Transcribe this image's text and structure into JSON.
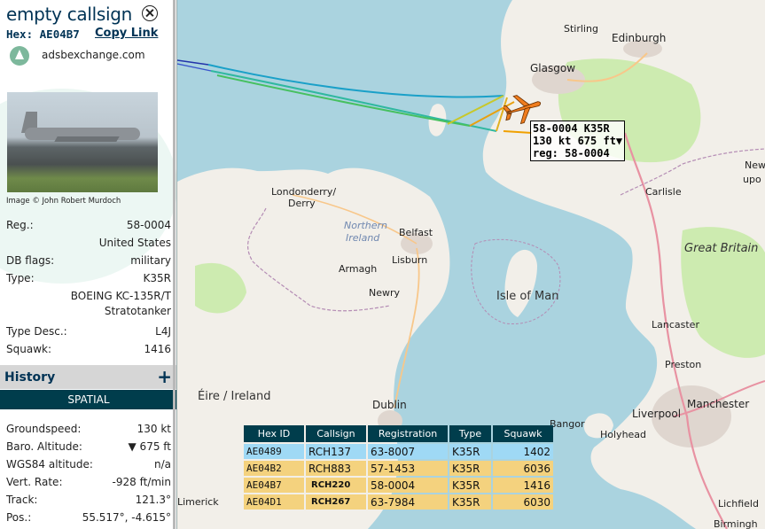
{
  "aircraft": {
    "callsign": "empty callsign",
    "hex_label": "Hex:",
    "hex": "AE04B7",
    "copy_link": "Copy Link",
    "source": "adsbexchange.com",
    "photo_credit": "Image © John Robert Murdoch"
  },
  "details": [
    {
      "key": "Reg.:",
      "value": "58-0004"
    },
    {
      "key": "",
      "value": "United States"
    },
    {
      "key": "DB flags:",
      "value": "military"
    },
    {
      "key": "Type:",
      "value": "K35R"
    },
    {
      "key": "",
      "value": "BOEING KC-135R/T Stratotanker"
    },
    {
      "key": "Type Desc.:",
      "value": "L4J"
    },
    {
      "key": "Squawk:",
      "value": "1416"
    }
  ],
  "history_label": "History",
  "spatial_label": "SPATIAL",
  "spatial": [
    {
      "key": "Groundspeed:",
      "value": "130 kt"
    },
    {
      "key": "Baro. Altitude:",
      "value": "▼ 675 ft"
    },
    {
      "key": "WGS84 altitude:",
      "value": "n/a"
    },
    {
      "key": "Vert. Rate:",
      "value": "-928 ft/min"
    },
    {
      "key": "Track:",
      "value": "121.3°"
    },
    {
      "key": "Pos.:",
      "value": "55.517°, -4.615°"
    }
  ],
  "map_labels": {
    "edinburgh": "Edinburgh",
    "glasgow": "Glasgow",
    "stirling": "Stirling",
    "carlisle": "Carlisle",
    "great_britain": "Great Britain",
    "newcastle": "New",
    "newcastle2": "upo",
    "londonderry": "Londonderry/",
    "derry": "Derry",
    "northern_ireland": "Northern",
    "northern_ireland2": "Ireland",
    "belfast": "Belfast",
    "lisburn": "Lisburn",
    "armagh": "Armagh",
    "newry": "Newry",
    "isle_of_man": "Isle of Man",
    "eire": "Éire / Ireland",
    "dublin": "Dublin",
    "lancaster": "Lancaster",
    "preston": "Preston",
    "liverpool": "Liverpool",
    "manchester": "Manchester",
    "bangor": "Bangor",
    "holyhead": "Holyhead",
    "limerick": "Limerick",
    "lichfield": "Lichfield",
    "birmingham": "Birmingh"
  },
  "aircraft_label": {
    "line1": "58-0004 K35R",
    "line2": "130 kt  675 ft▼",
    "line3": "reg: 58-0004"
  },
  "table": {
    "headers": [
      "Hex ID",
      "Callsign",
      "Registration",
      "Type",
      "Squawk"
    ],
    "rows": [
      {
        "hex": "AE0489",
        "callsign": "RCH137",
        "reg": "63-8007",
        "type": "K35R",
        "squawk": "1402"
      },
      {
        "hex": "AE04B2",
        "callsign": "RCH883",
        "reg": "57-1453",
        "type": "K35R",
        "squawk": "6036"
      },
      {
        "hex": "AE04B7",
        "callsign": "RCH220",
        "reg": "58-0004",
        "type": "K35R",
        "squawk": "1416"
      },
      {
        "hex": "AE04D1",
        "callsign": "RCH267",
        "reg": "63-7984",
        "type": "K35R",
        "squawk": "6030"
      }
    ]
  },
  "colors": {
    "accent": "#003355",
    "header_bg": "#003d4c",
    "selected_row": "#9fd9f5",
    "row": "#f4d27e",
    "aircraft_icon": "#f07d1e",
    "water": "#aad3df",
    "land": "#f2efe9"
  }
}
